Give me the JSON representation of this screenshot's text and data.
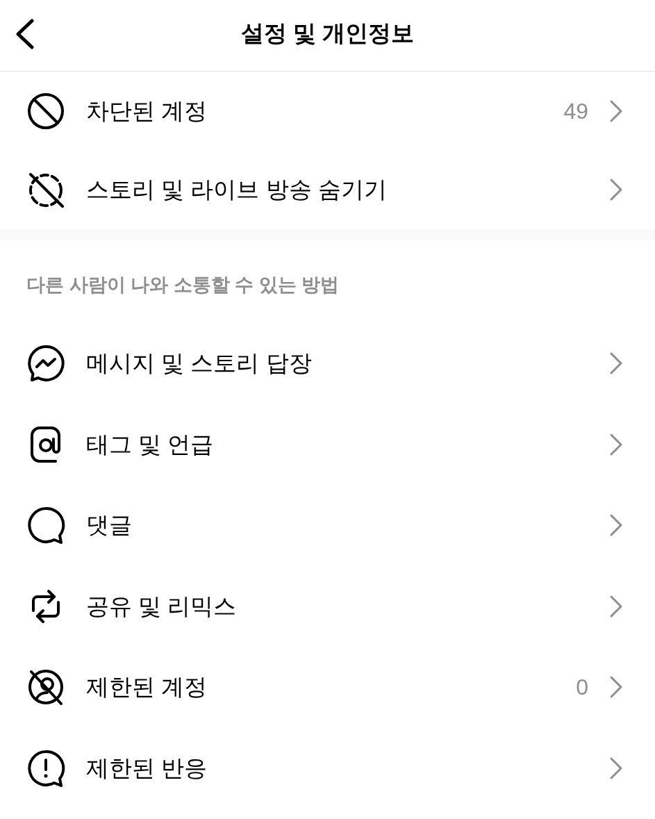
{
  "header": {
    "title": "설정 및 개인정보"
  },
  "sections": [
    {
      "items": [
        {
          "label": "차단된 계정",
          "count": "49"
        },
        {
          "label": "스토리 및 라이브 방송 숨기기"
        }
      ]
    },
    {
      "heading": "다른 사람이 나와 소통할 수 있는 방법",
      "items": [
        {
          "label": "메시지 및 스토리 답장"
        },
        {
          "label": "태그 및 언급"
        },
        {
          "label": "댓글"
        },
        {
          "label": "공유 및 리믹스"
        },
        {
          "label": "제한된 계정",
          "count": "0"
        },
        {
          "label": "제한된 반응"
        }
      ]
    }
  ]
}
